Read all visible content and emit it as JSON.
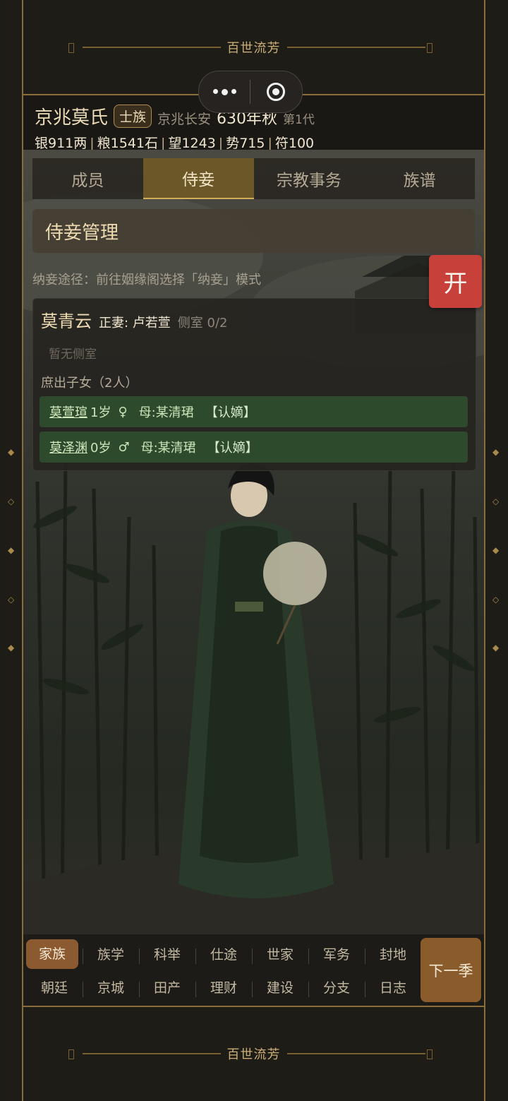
{
  "banner": {
    "top_title": "百世流芳",
    "bottom_title": "百世流芳"
  },
  "capsule": {
    "more_icon": "more-dots-icon",
    "close_icon": "target-close-icon"
  },
  "header": {
    "family_name": "京兆莫氏",
    "rank": "士族",
    "location": "京兆长安",
    "date": "630年秋",
    "generation": "第1代",
    "resources": [
      "银911两",
      "粮1541石",
      "望1243",
      "势715",
      "符100"
    ],
    "separator": "|"
  },
  "tabs": [
    {
      "label": "成员",
      "active": false
    },
    {
      "label": "侍妾",
      "active": true
    },
    {
      "label": "宗教事务",
      "active": false
    },
    {
      "label": "族谱",
      "active": false
    }
  ],
  "panel": {
    "title": "侍妾管理",
    "hint": "纳妾途径：前往姻缘阁选择「纳妾」模式",
    "open_button": "开"
  },
  "card": {
    "name": "莫青云",
    "spouse": "正妻: 卢若萱",
    "concubine_count": "侧室 0/2",
    "no_concubine": "暂无侧室",
    "children_title": "庶出子女（2人）",
    "children": [
      {
        "name": "莫萱瑄",
        "age": "1岁",
        "gender_symbol": "♀",
        "mother": "母:某清珺",
        "tag": "【认嫡】"
      },
      {
        "name": "莫泽渊",
        "age": "0岁",
        "gender_symbol": "♂",
        "mother": "母:某清珺",
        "tag": "【认嫡】"
      }
    ]
  },
  "nav": {
    "row1": [
      "家族",
      "族学",
      "科举",
      "仕途",
      "世家",
      "军务",
      "封地"
    ],
    "row2": [
      "朝廷",
      "京城",
      "田产",
      "理财",
      "建设",
      "分支",
      "日志"
    ],
    "active": "家族",
    "next_button": "下一季"
  },
  "colors": {
    "accent": "#8c5a30",
    "open_button": "#c8403a",
    "child_row": "#2e4a2c",
    "frame": "#8a6d3a"
  }
}
